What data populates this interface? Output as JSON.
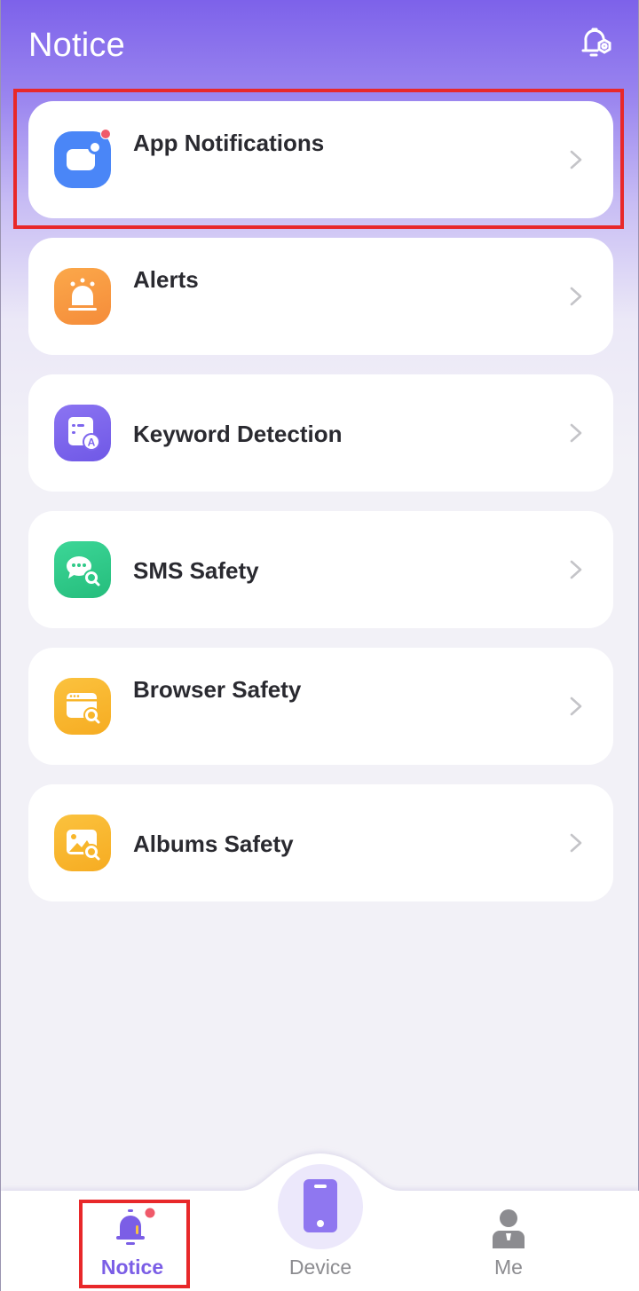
{
  "header": {
    "title": "Notice",
    "settings_icon": "bell-settings-icon"
  },
  "menu": {
    "items": [
      {
        "label": "App Notifications",
        "icon": "app-notification-icon",
        "color": "#4a86f7",
        "has_badge": true
      },
      {
        "label": "Alerts",
        "icon": "siren-icon",
        "color": "#f79a3e",
        "has_badge": false
      },
      {
        "label": "Keyword Detection",
        "icon": "keyword-icon",
        "color": "#7d66ee",
        "has_badge": false
      },
      {
        "label": "SMS Safety",
        "icon": "chat-search-icon",
        "color": "#2ec987",
        "has_badge": false
      },
      {
        "label": "Browser Safety",
        "icon": "browser-search-icon",
        "color": "#f8b62a",
        "has_badge": false
      },
      {
        "label": "Albums Safety",
        "icon": "image-search-icon",
        "color": "#f8b62a",
        "has_badge": false
      }
    ]
  },
  "bottom_nav": {
    "items": [
      {
        "label": "Notice",
        "icon": "bell-icon",
        "active": true,
        "has_badge": true
      },
      {
        "label": "Device",
        "icon": "phone-icon",
        "active": false
      },
      {
        "label": "Me",
        "icon": "person-icon",
        "active": false
      }
    ]
  },
  "colors": {
    "accent": "#7b5ee6",
    "badge": "#f05a6a",
    "highlight": "#e8282a",
    "inactive_text": "#8c8c90"
  }
}
